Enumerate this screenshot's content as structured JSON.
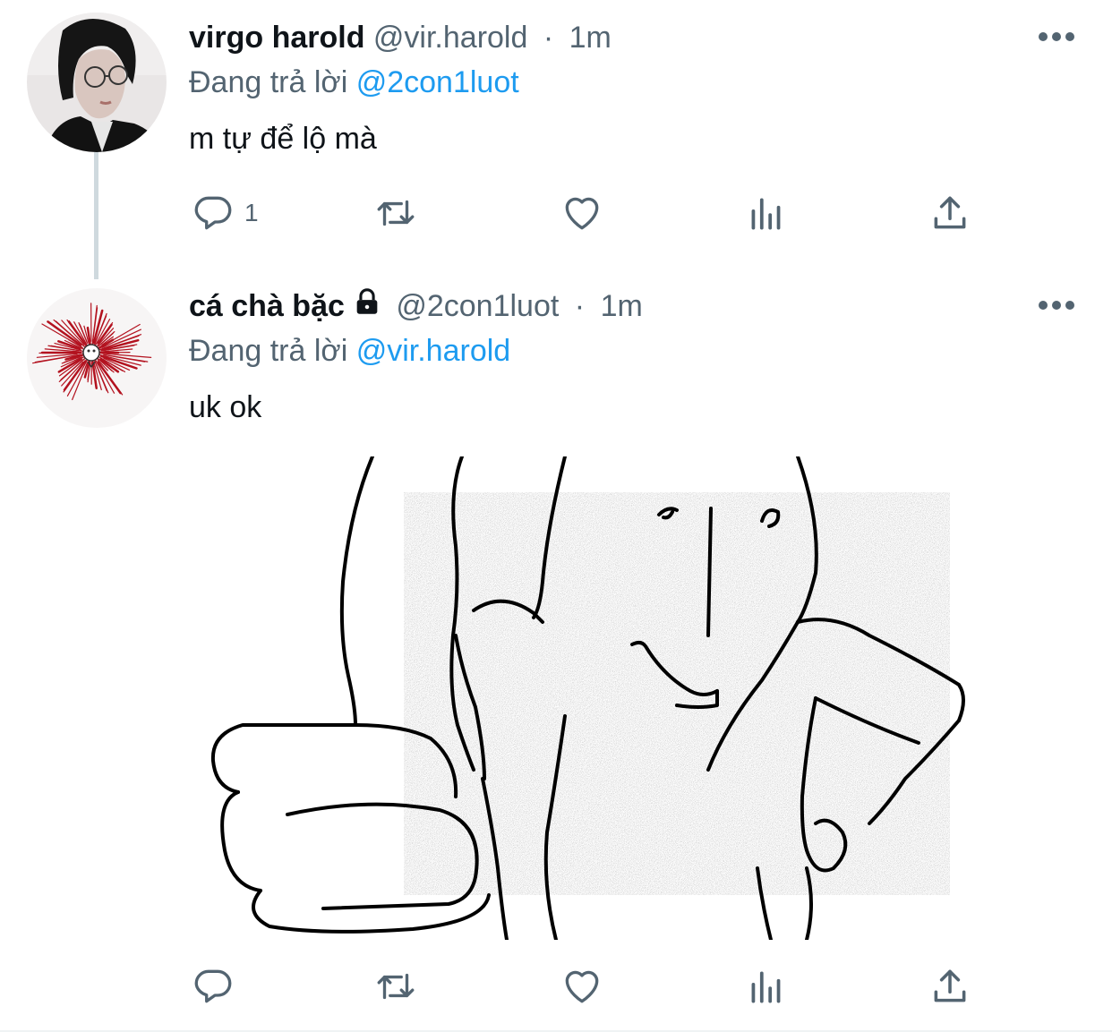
{
  "tweets": [
    {
      "name": "virgo harold",
      "handle": "@vir.harold",
      "time": "1m",
      "dot": "·",
      "reply_prefix": "Đang trả lời",
      "reply_to": "@2con1luot",
      "text": "m tự để lộ mà",
      "reply_count": "1",
      "protected": false
    },
    {
      "name": "cá chà bặc",
      "handle": "@2con1luot",
      "time": "1m",
      "dot": "·",
      "reply_prefix": "Đang trả lời",
      "reply_to": "@vir.harold",
      "text": "uk ok",
      "reply_count": "",
      "protected": true,
      "has_media": true
    }
  ],
  "icons": {
    "reply": "reply-icon",
    "retweet": "retweet-icon",
    "like": "heart-icon",
    "analytics": "analytics-icon",
    "share": "share-icon",
    "more": "more-icon",
    "lock": "lock-icon"
  },
  "colors": {
    "text_primary": "#0f1419",
    "text_secondary": "#536471",
    "link": "#1d9bf0",
    "thread_line": "#cfd9de",
    "avatar_splash": "#b3121f"
  }
}
